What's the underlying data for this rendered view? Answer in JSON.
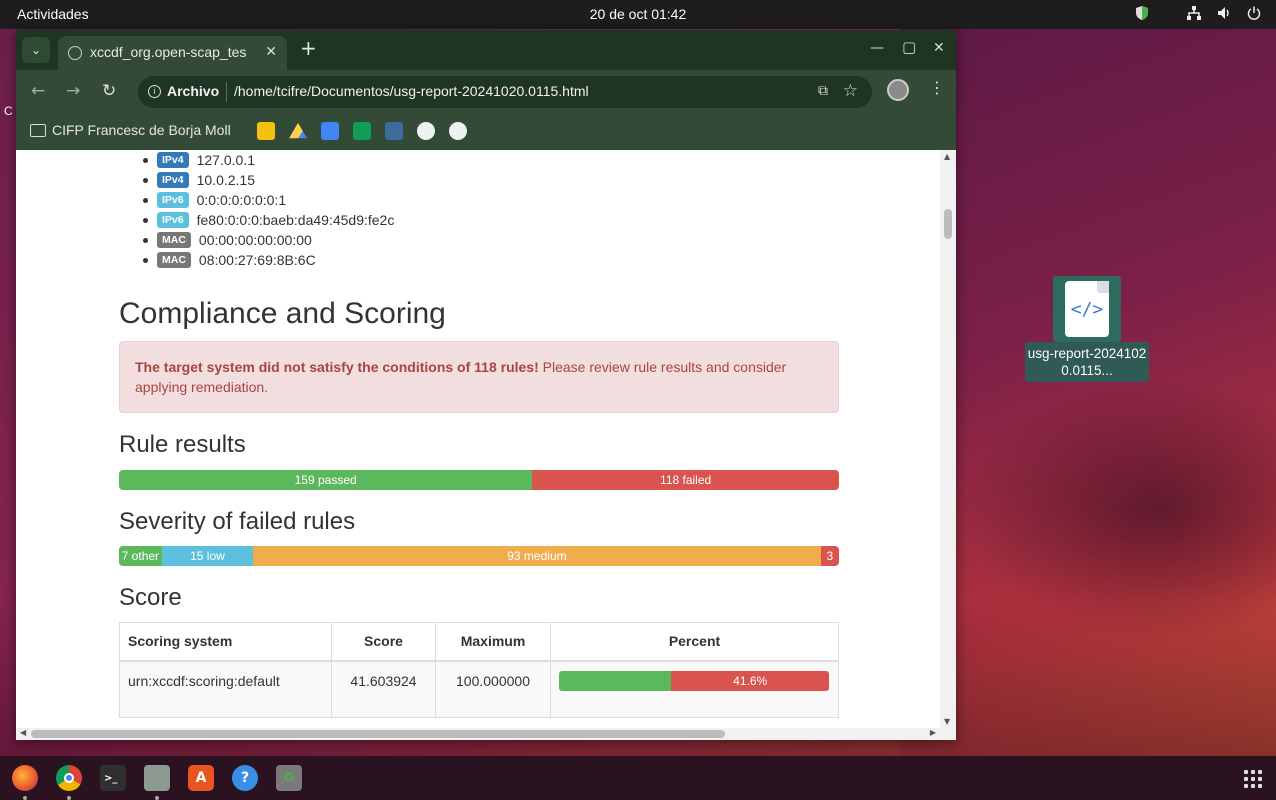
{
  "topbar": {
    "activities": "Actividades",
    "clock": "20 de oct  01:42"
  },
  "desktop": {
    "file_label": "usg-report-20241020.0115...",
    "left_partial": "C"
  },
  "browser": {
    "tab_title": "xccdf_org.open-scap_tes",
    "url_chip": "Archivo",
    "url": "/home/tcifre/Documentos/usg-report-20241020.0115.html",
    "bookmark_folder": "CIFP Francesc de Borja Moll"
  },
  "report": {
    "addresses": [
      {
        "type": "IPv4",
        "value": "127.0.0.1"
      },
      {
        "type": "IPv4",
        "value": "10.0.2.15"
      },
      {
        "type": "IPv6",
        "value": "0:0:0:0:0:0:0:1"
      },
      {
        "type": "IPv6",
        "value": "fe80:0:0:0:baeb:da49:45d9:fe2c"
      },
      {
        "type": "MAC",
        "value": "00:00:00:00:00:00"
      },
      {
        "type": "MAC",
        "value": "08:00:27:69:8B:6C"
      }
    ],
    "compliance_title": "Compliance and Scoring",
    "alert_strong": "The target system did not satisfy the conditions of 118 rules!",
    "alert_rest": " Please review rule results and consider applying remediation.",
    "rule_results_title": "Rule results",
    "rule_results": {
      "passed": 159,
      "failed": 118,
      "passed_label": "159 passed",
      "failed_label": "118 failed"
    },
    "severity_title": "Severity of failed rules",
    "severity": [
      {
        "label": "7 other",
        "count": 7,
        "color": "#5cb85c"
      },
      {
        "label": "15 low",
        "count": 15,
        "color": "#5bc0de"
      },
      {
        "label": "93 medium",
        "count": 93,
        "color": "#f0ad4e"
      },
      {
        "label": "3",
        "count": 3,
        "color": "#d9534f"
      }
    ],
    "score_title": "Score",
    "score_table": {
      "headers": [
        "Scoring system",
        "Score",
        "Maximum",
        "Percent"
      ],
      "row": {
        "system": "urn:xccdf:scoring:default",
        "score": "41.603924",
        "maximum": "100.000000",
        "percent_label": "41.6%",
        "percent": 41.6
      }
    }
  },
  "colors": {
    "passed": "#5cb85c",
    "failed": "#d9534f"
  }
}
